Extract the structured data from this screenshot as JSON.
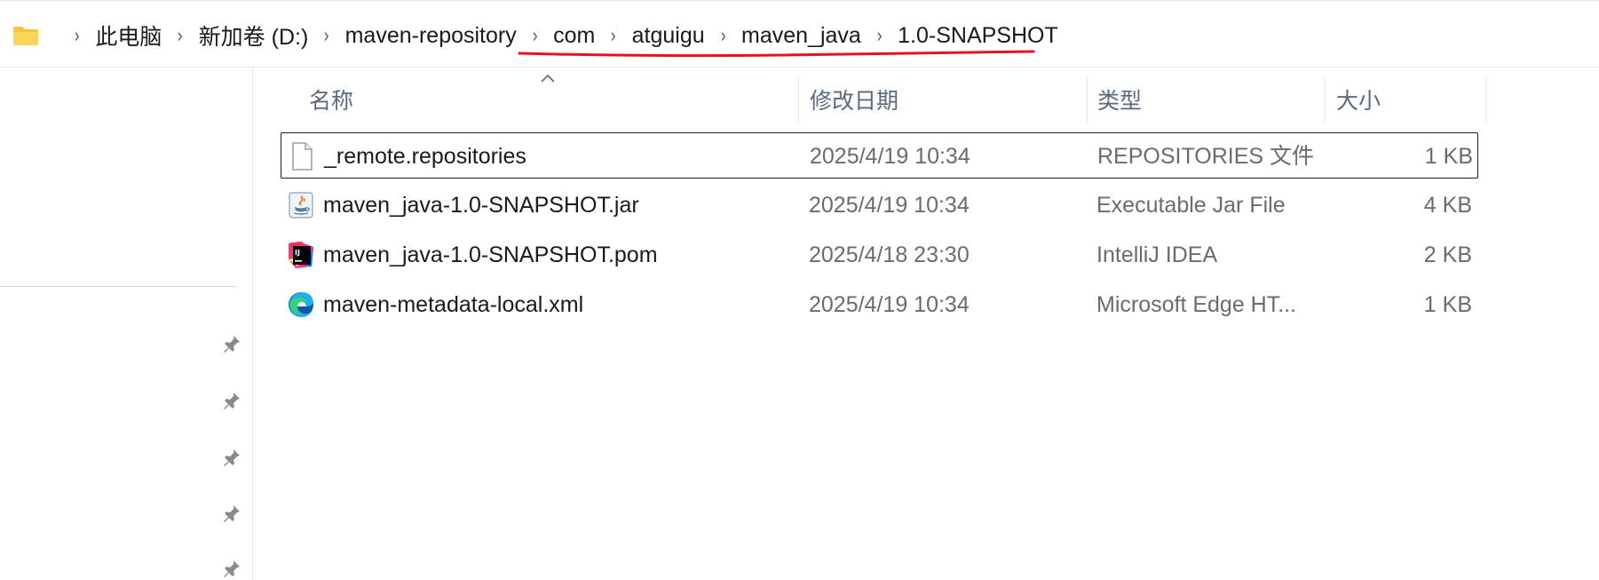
{
  "breadcrumb": {
    "items": [
      "此电脑",
      "新加卷 (D:)",
      "maven-repository",
      "com",
      "atguigu",
      "maven_java",
      "1.0-SNAPSHOT"
    ],
    "separator": "›"
  },
  "columns": {
    "name": "名称",
    "modified": "修改日期",
    "type": "类型",
    "size": "大小"
  },
  "files": [
    {
      "name": "_remote.repositories",
      "modified": "2025/4/19 10:34",
      "type": "REPOSITORIES 文件",
      "size": "1 KB",
      "icon": "generic-file-icon",
      "selected": true
    },
    {
      "name": "maven_java-1.0-SNAPSHOT.jar",
      "modified": "2025/4/19 10:34",
      "type": "Executable Jar File",
      "size": "4 KB",
      "icon": "java-jar-icon",
      "selected": false
    },
    {
      "name": "maven_java-1.0-SNAPSHOT.pom",
      "modified": "2025/4/18 23:30",
      "type": "IntelliJ IDEA",
      "size": "2 KB",
      "icon": "intellij-icon",
      "selected": false
    },
    {
      "name": "maven-metadata-local.xml",
      "modified": "2025/4/19 10:34",
      "type": "Microsoft Edge HT...",
      "size": "1 KB",
      "icon": "edge-icon",
      "selected": false
    }
  ],
  "colors": {
    "highlight_underline": "#e81123",
    "header_text": "#5a6a7c",
    "folder_yellow": "#f8c43a"
  }
}
